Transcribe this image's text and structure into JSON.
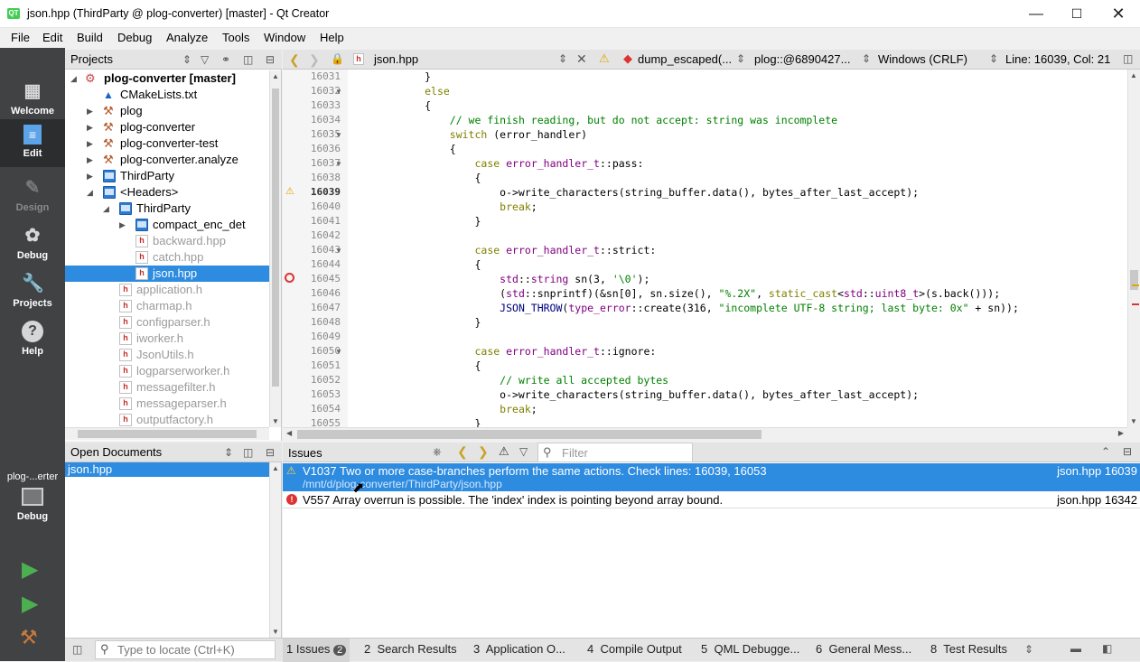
{
  "window": {
    "title": "json.hpp (ThirdParty @ plog-converter) [master] - Qt Creator",
    "app_icon": "QT"
  },
  "menu": [
    "File",
    "Edit",
    "Build",
    "Debug",
    "Analyze",
    "Tools",
    "Window",
    "Help"
  ],
  "modes": [
    {
      "label": "Welcome",
      "icon": "grid-icon"
    },
    {
      "label": "Edit",
      "icon": "document-icon"
    },
    {
      "label": "Design",
      "icon": "pen-icon"
    },
    {
      "label": "Debug",
      "icon": "bug-icon"
    },
    {
      "label": "Projects",
      "icon": "wrench-icon"
    },
    {
      "label": "Help",
      "icon": "question-icon"
    }
  ],
  "kit": {
    "name": "plog-...erter",
    "mode": "Debug"
  },
  "projects": {
    "header": "Projects",
    "tree": [
      {
        "label": "plog-converter [master]",
        "bold": true
      },
      {
        "label": "CMakeLists.txt"
      },
      {
        "label": "plog"
      },
      {
        "label": "plog-converter"
      },
      {
        "label": "plog-converter-test"
      },
      {
        "label": "plog-converter.analyze"
      },
      {
        "label": "ThirdParty"
      },
      {
        "label": "<Headers>"
      },
      {
        "label": "ThirdParty"
      },
      {
        "label": "compact_enc_det"
      },
      {
        "label": "backward.hpp"
      },
      {
        "label": "catch.hpp"
      },
      {
        "label": "json.hpp"
      },
      {
        "label": "application.h"
      },
      {
        "label": "charmap.h"
      },
      {
        "label": "configparser.h"
      },
      {
        "label": "iworker.h"
      },
      {
        "label": "JsonUtils.h"
      },
      {
        "label": "logparserworker.h"
      },
      {
        "label": "messagefilter.h"
      },
      {
        "label": "messageparser.h"
      },
      {
        "label": "outputfactory.h"
      }
    ]
  },
  "open_documents": {
    "header": "Open Documents",
    "items": [
      "json.hpp"
    ]
  },
  "editor": {
    "file": "json.hpp",
    "symbol": "dump_escaped(...",
    "address": "plog::@6890427...",
    "line_ending": "Windows (CRLF)",
    "position": "Line: 16039, Col: 21",
    "lines": [
      {
        "n": "16031",
        "text": "            }"
      },
      {
        "n": "16032",
        "text": "            else"
      },
      {
        "n": "16033",
        "text": "            {"
      },
      {
        "n": "16034",
        "text": "                // we finish reading, but do not accept: string was incomplete"
      },
      {
        "n": "16035",
        "text": "                switch (error_handler)"
      },
      {
        "n": "16036",
        "text": "                {"
      },
      {
        "n": "16037",
        "text": "                    case error_handler_t::pass:"
      },
      {
        "n": "16038",
        "text": "                    {"
      },
      {
        "n": "16039",
        "text": "                        o->write_characters(string_buffer.data(), bytes_after_last_accept);"
      },
      {
        "n": "16040",
        "text": "                        break;"
      },
      {
        "n": "16041",
        "text": "                    }"
      },
      {
        "n": "16042",
        "text": ""
      },
      {
        "n": "16043",
        "text": "                    case error_handler_t::strict:"
      },
      {
        "n": "16044",
        "text": "                    {"
      },
      {
        "n": "16045",
        "text": "                        std::string sn(3, '\\0');"
      },
      {
        "n": "16046",
        "text": "                        (std::snprintf)(&sn[0], sn.size(), \"%.2X\", static_cast<std::uint8_t>(s.back()));"
      },
      {
        "n": "16047",
        "text": "                        JSON_THROW(type_error::create(316, \"incomplete UTF-8 string; last byte: 0x\" + sn));"
      },
      {
        "n": "16048",
        "text": "                    }"
      },
      {
        "n": "16049",
        "text": ""
      },
      {
        "n": "16050",
        "text": "                    case error_handler_t::ignore:"
      },
      {
        "n": "16051",
        "text": "                    {"
      },
      {
        "n": "16052",
        "text": "                        // write all accepted bytes"
      },
      {
        "n": "16053",
        "text": "                        o->write_characters(string_buffer.data(), bytes_after_last_accept);"
      },
      {
        "n": "16054",
        "text": "                        break;"
      },
      {
        "n": "16055",
        "text": "                    }"
      }
    ]
  },
  "issues": {
    "header": "Issues",
    "filter_placeholder": "Filter",
    "items": [
      {
        "text": "V1037 Two or more case-branches perform the same actions. Check lines: 16039, 16053",
        "path": "/mnt/d/plog-converter/ThirdParty/json.hpp",
        "location": "json.hpp 16039",
        "severity": "warning"
      },
      {
        "text": "V557 Array overrun is possible. The 'index' index is pointing beyond array bound.",
        "location": "json.hpp 16342",
        "severity": "error"
      }
    ]
  },
  "statusbar": {
    "locator_placeholder": "Type to locate (Ctrl+K)",
    "tabs": [
      {
        "num": "1",
        "label": "Issues",
        "badge": "2"
      },
      {
        "num": "2",
        "label": "Search Results"
      },
      {
        "num": "3",
        "label": "Application O..."
      },
      {
        "num": "4",
        "label": "Compile Output"
      },
      {
        "num": "5",
        "label": "QML Debugge..."
      },
      {
        "num": "6",
        "label": "General Mess..."
      },
      {
        "num": "8",
        "label": "Test Results"
      }
    ]
  },
  "colors": {
    "selection": "#2d8be0",
    "modebar": "#404244",
    "keyword": "#808000",
    "comment": "#008000",
    "type": "#800080"
  }
}
